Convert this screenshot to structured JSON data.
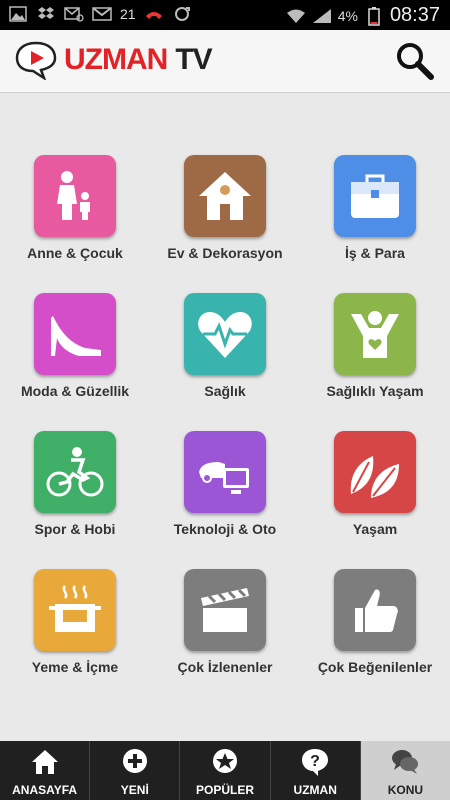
{
  "status_bar": {
    "notification_count": "21",
    "battery_percent": "4%",
    "time": "08:37",
    "icons": [
      "image-icon",
      "dropbox-icon",
      "mail-at-icon",
      "gmail-icon",
      "missed-call-icon",
      "sync-icon",
      "wifi-icon",
      "signal-icon",
      "battery-icon"
    ]
  },
  "header": {
    "logo_text": "UZMAN",
    "logo_suffix": "TV",
    "logo_color": "#e32227",
    "search_icon": "search-icon"
  },
  "categories": [
    {
      "label": "Anne & Çocuk",
      "color": "#e85aa0",
      "icon": "mother-child-icon"
    },
    {
      "label": "Ev & Dekorasyon",
      "color": "#9e6a45",
      "icon": "house-icon"
    },
    {
      "label": "İş & Para",
      "color": "#4f8ee6",
      "icon": "briefcase-icon"
    },
    {
      "label": "Moda & Güzellik",
      "color": "#d54ec9",
      "icon": "high-heel-icon"
    },
    {
      "label": "Sağlık",
      "color": "#39b3ad",
      "icon": "heart-pulse-icon"
    },
    {
      "label": "Sağlıklı Yaşam",
      "color": "#8cb64a",
      "icon": "healthy-person-icon"
    },
    {
      "label": "Spor & Hobi",
      "color": "#3fae66",
      "icon": "cyclist-icon"
    },
    {
      "label": "Teknoloji & Oto",
      "color": "#9b56d6",
      "icon": "car-computer-icon"
    },
    {
      "label": "Yaşam",
      "color": "#d64646",
      "icon": "leaves-icon"
    },
    {
      "label": "Yeme & İçme",
      "color": "#e9a93a",
      "icon": "hot-pot-icon"
    },
    {
      "label": "Çok İzlenenler",
      "color": "#7d7d7d",
      "icon": "clapperboard-icon"
    },
    {
      "label": "Çok Beğenilenler",
      "color": "#7d7d7d",
      "icon": "thumbs-up-icon"
    }
  ],
  "tabs": [
    {
      "label": "ANASAYFA",
      "icon": "home-icon",
      "selected": false
    },
    {
      "label": "YENİ",
      "icon": "plus-circle-icon",
      "selected": false
    },
    {
      "label": "POPÜLER",
      "icon": "star-badge-icon",
      "selected": false
    },
    {
      "label": "UZMAN",
      "icon": "question-bubble-icon",
      "selected": false
    },
    {
      "label": "KONU",
      "icon": "chat-bubbles-icon",
      "selected": true
    }
  ]
}
